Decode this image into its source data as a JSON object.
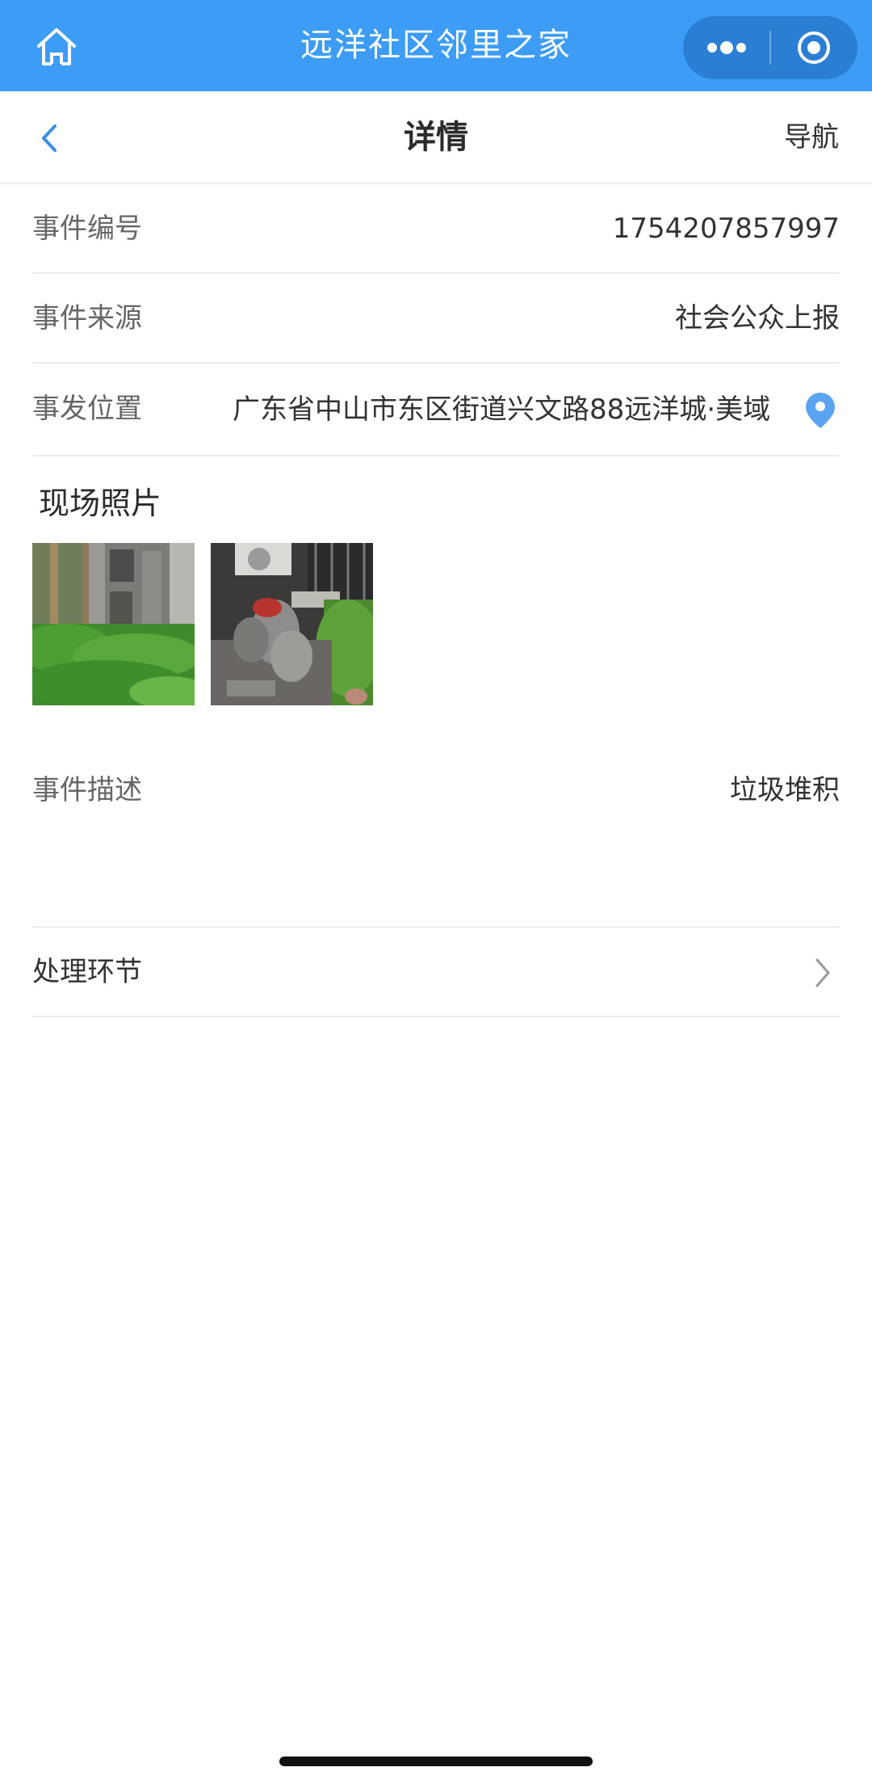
{
  "app": {
    "title": "远洋社区邻里之家",
    "accent_color": "#3d9cf6",
    "home_icon": "home-icon",
    "more_icon": "more-dots-icon",
    "close_icon": "target-close-icon"
  },
  "nav": {
    "title": "详情",
    "back_icon": "chevron-left-icon",
    "action_label": "导航"
  },
  "event": {
    "number_label": "事件编号",
    "number_value": "1754207857997",
    "source_label": "事件来源",
    "source_value": "社会公众上报",
    "location_label": "事发位置",
    "location_value": "广东省中山市东区街道兴文路88远洋城·美域",
    "location_icon": "map-pin-icon",
    "photos_label": "现场照片",
    "photos": [
      {
        "name": "scene-photo-1",
        "subject": "garden-building"
      },
      {
        "name": "scene-photo-2",
        "subject": "garbage-bags"
      }
    ],
    "description_label": "事件描述",
    "description_value": "垃圾堆积",
    "process_label": "处理环节",
    "process_icon": "chevron-right-icon"
  }
}
